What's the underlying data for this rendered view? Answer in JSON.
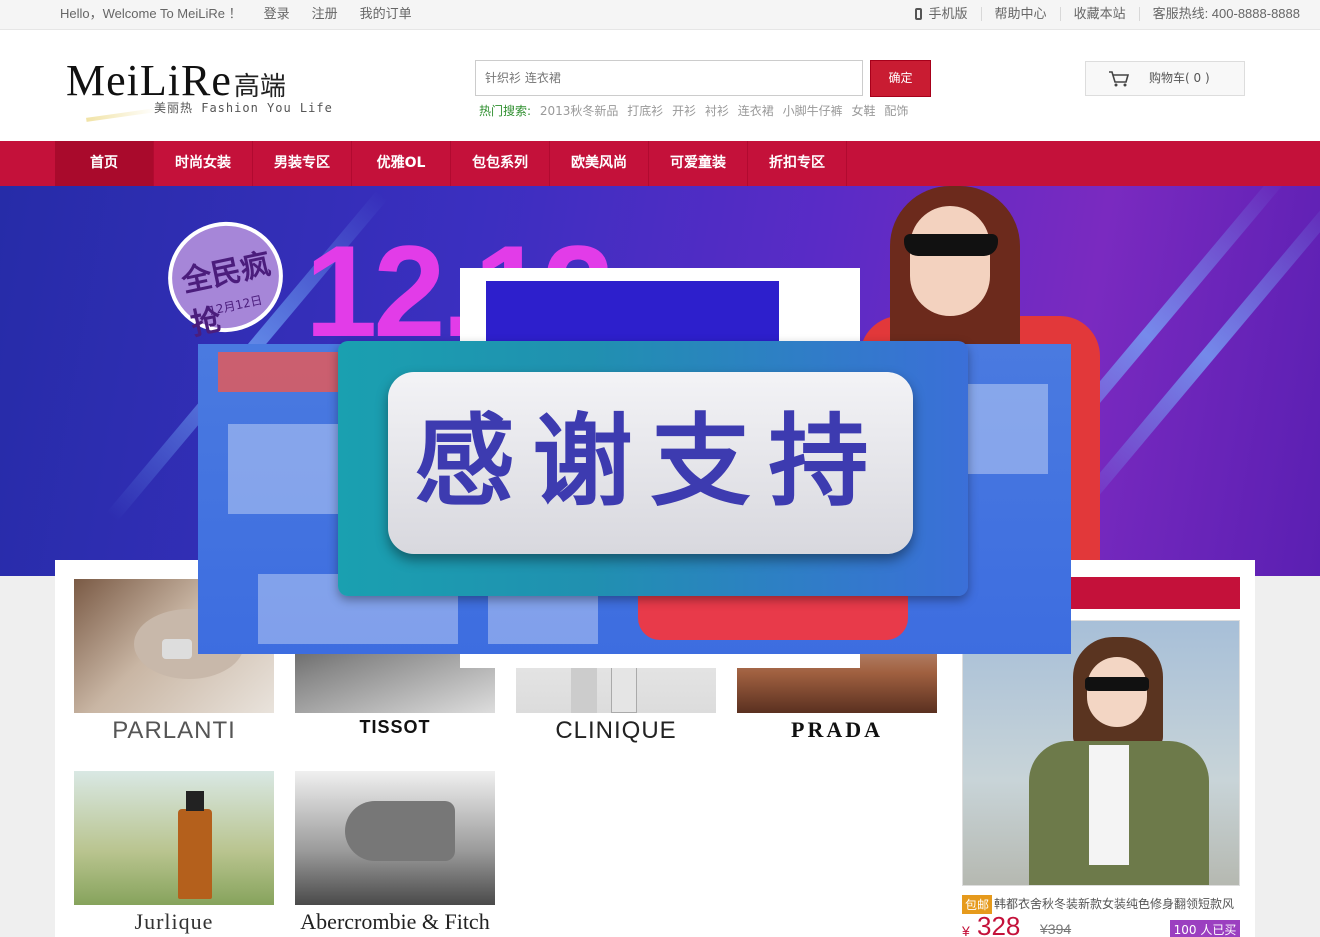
{
  "topbar": {
    "welcome": "Hello，Welcome To MeiLiRe ！",
    "login": "登录",
    "register": "注册",
    "orders": "我的订单",
    "mobile": "手机版",
    "help": "帮助中心",
    "favorite": "收藏本站",
    "hotline": "客服热线: 400-8888-8888"
  },
  "logo": {
    "brand": "MeiLiRe",
    "brand_cn": "高端",
    "tagline": "美丽热 Fashion You Life"
  },
  "search": {
    "placeholder": "针织衫 连衣裙",
    "button": "确定",
    "hot_label": "热门搜索:",
    "hot_keywords": [
      "2013秋冬新品",
      "打底衫",
      "开衫",
      "衬衫",
      "连衣裙",
      "小脚牛仔裤",
      "女鞋",
      "配饰"
    ]
  },
  "cart": {
    "label": "购物车( 0 )"
  },
  "nav": {
    "items": [
      "首页",
      "时尚女装",
      "男装专区",
      "优雅OL",
      "包包系列",
      "欧美风尚",
      "可爱童装",
      "折扣专区"
    ]
  },
  "banner": {
    "number": "12.12",
    "badge_text": "全民疯抢",
    "badge_date": "12月12日"
  },
  "popup": {
    "message": "感谢支持"
  },
  "brands": [
    "PARLANTI",
    "TISSOT",
    "CLINIQUE",
    "PRADA",
    "Jurlique",
    "Abercrombie & Fitch"
  ],
  "product": {
    "tag": "包邮",
    "title": "韩都衣舍秋冬装新款女装纯色修身翻领短款风",
    "currency": "¥",
    "price": "328",
    "old_price": "¥394",
    "sold": "100 人已买"
  },
  "colors": {
    "brand_red": "#c4113a",
    "popup_text": "#3d3bb0"
  }
}
